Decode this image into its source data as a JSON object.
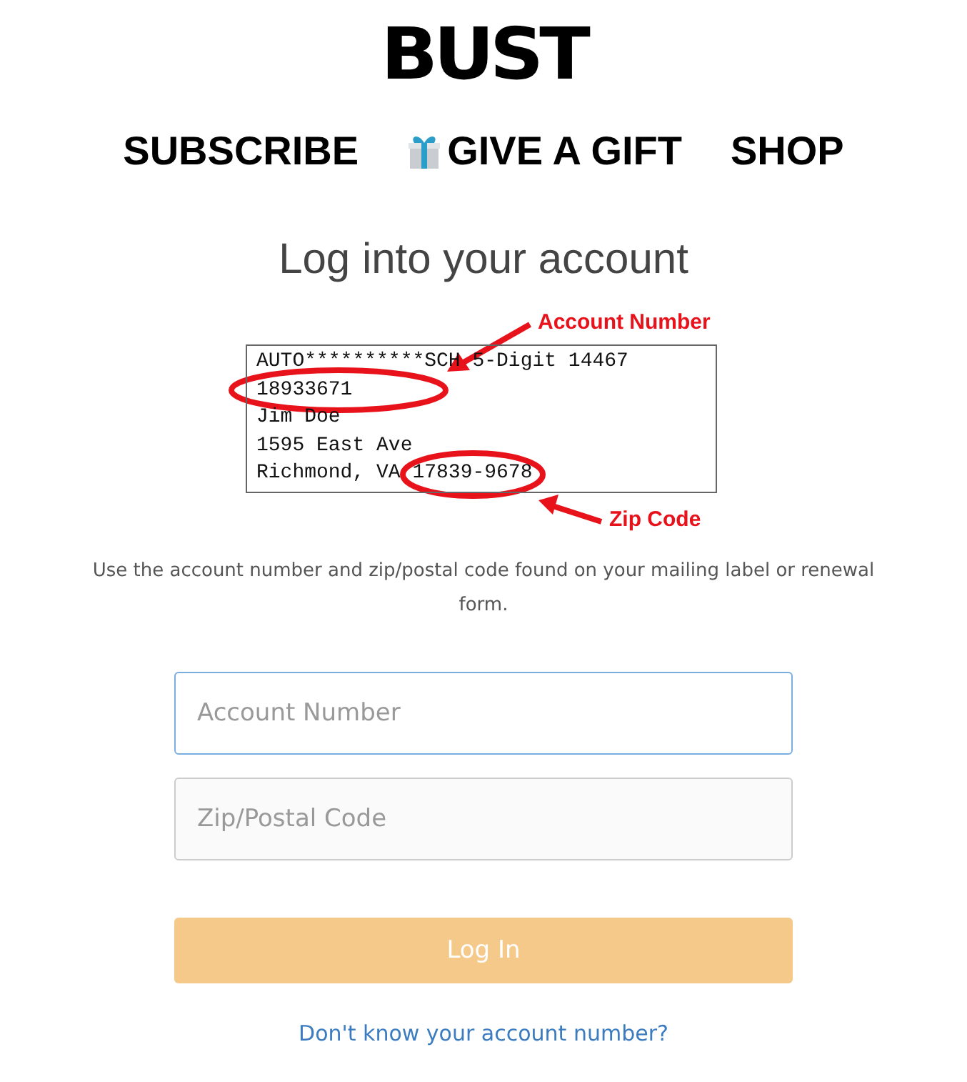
{
  "logo": "BUST",
  "nav": [
    {
      "label": "SUBSCRIBE",
      "icon": false
    },
    {
      "label": "GIVE A GIFT",
      "icon": true
    },
    {
      "label": "SHOP",
      "icon": false
    }
  ],
  "heading": "Log into your account",
  "label_example": {
    "lines": [
      [
        "AUTO**********SCH 5-Digit 14467"
      ],
      [
        "18933671"
      ],
      [
        "Jim Doe"
      ],
      [
        "1595 East Ave"
      ],
      [
        "Richmond, VA",
        "17839-9678"
      ]
    ],
    "annotations": [
      "Account Number",
      "Zip Code"
    ]
  },
  "instructions": "Use the account number and zip/postal code found on your mailing label or renewal form.",
  "fields": [
    {
      "placeholder": "Account Number",
      "focused": true
    },
    {
      "placeholder": "Zip/Postal Code",
      "focused": false
    }
  ],
  "submit": {
    "label": "Log In",
    "disabled": true
  },
  "help_link": "Don't know your account number?"
}
